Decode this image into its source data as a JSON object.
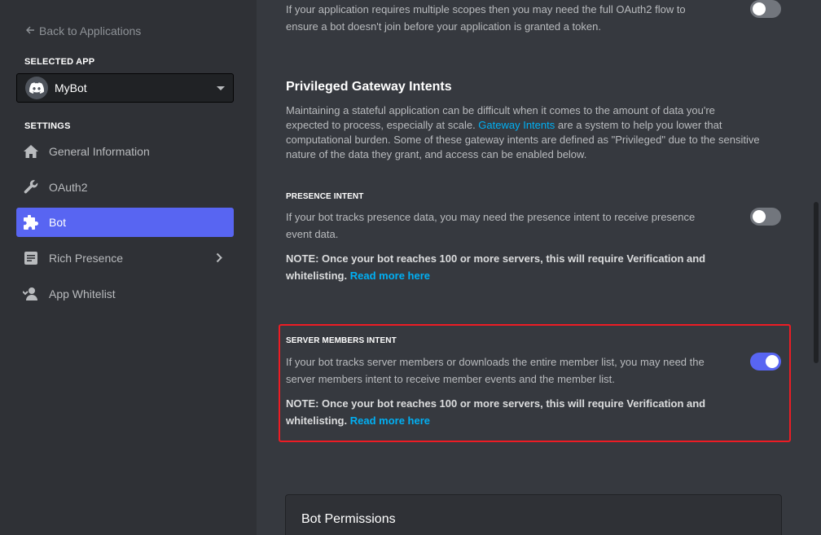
{
  "sidebar": {
    "back_label": "Back to Applications",
    "selected_app_label": "SELECTED APP",
    "app_name": "MyBot",
    "settings_label": "SETTINGS",
    "items": [
      {
        "label": "General Information",
        "icon": "home-icon"
      },
      {
        "label": "OAuth2",
        "icon": "wrench-icon"
      },
      {
        "label": "Bot",
        "icon": "puzzle-icon",
        "active": true
      },
      {
        "label": "Rich Presence",
        "icon": "document-icon"
      },
      {
        "label": "App Whitelist",
        "icon": "user-whitelist-icon"
      }
    ]
  },
  "main": {
    "top_text": {
      "line1": "If your application requires multiple scopes then you may need the full OAuth2 flow to",
      "line2": "ensure a bot doesn't join before your application is granted a token."
    },
    "privileged": {
      "title": "Privileged Gateway Intents",
      "desc_line1": "Maintaining a stateful application can be difficult when it comes to the amount of data you're",
      "desc_line2_pre": "expected to process, especially at scale. ",
      "desc_line2_link": "Gateway Intents",
      "desc_line2_post": " are a system to help you lower that",
      "desc_line3": "computational burden. Some of these gateway intents are defined as \"Privileged\" due to the sensitive",
      "desc_line4": "nature of the data they grant, and access can be enabled below."
    },
    "presence_intent": {
      "label": "PRESENCE INTENT",
      "line1": "If your bot tracks presence data, you may need the presence intent to receive presence",
      "line2": "event data.",
      "note_line1": "NOTE: Once your bot reaches 100 or more servers, this will require Verification and",
      "note_line2": "whitelisting.",
      "link": "Read more here",
      "enabled": false
    },
    "server_members_intent": {
      "label": "SERVER MEMBERS INTENT",
      "line1": "If your bot tracks server members or downloads the entire member list, you may need the",
      "line2": "server members intent to receive member events and the member list.",
      "note_line1": "NOTE: Once your bot reaches 100 or more servers, this will require Verification and",
      "note_line2": "whitelisting.",
      "link": "Read more here",
      "enabled": true
    },
    "bot_permissions": {
      "title": "Bot Permissions"
    }
  },
  "colors": {
    "accent": "#5865f2",
    "link": "#00b0f4",
    "highlight": "#ed1c24"
  }
}
